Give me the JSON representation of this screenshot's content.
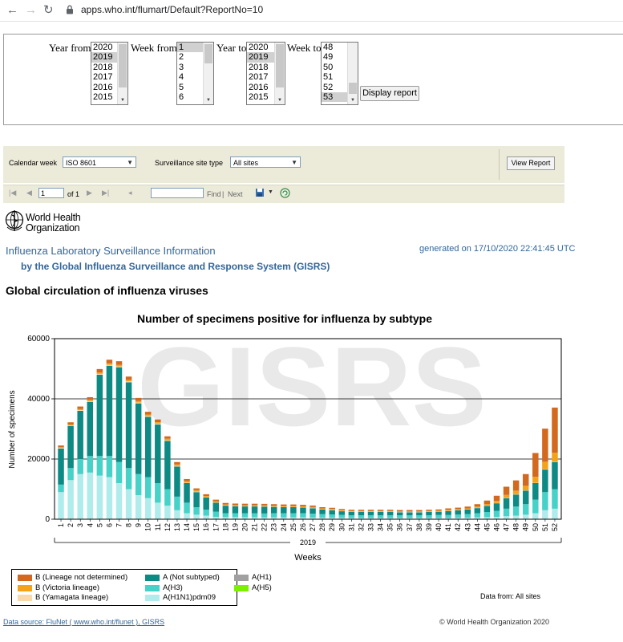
{
  "browser": {
    "url": "apps.who.int/flumart/Default?ReportNo=10"
  },
  "form": {
    "year_from_label": "Year from",
    "week_from_label": "Week from",
    "year_to_label": "Year to",
    "week_to_label": "Week to",
    "year_from_options": [
      "2020",
      "2019",
      "2018",
      "2017",
      "2016",
      "2015"
    ],
    "week_from_options": [
      "1",
      "2",
      "3",
      "4",
      "5",
      "6"
    ],
    "year_to_options": [
      "2020",
      "2019",
      "2018",
      "2017",
      "2016",
      "2015"
    ],
    "week_to_options": [
      "48",
      "49",
      "50",
      "51",
      "52",
      "53"
    ],
    "display_report_label": "Display report"
  },
  "viewer": {
    "calendar_week_label": "Calendar week",
    "calendar_week_value": "ISO 8601",
    "site_type_label": "Surveillance site type",
    "site_type_value": "All sites",
    "view_report_label": "View Report",
    "page_value": "1",
    "of_pages": "of 1",
    "find_label": "Find",
    "next_label": "Next",
    "separator": "|"
  },
  "report": {
    "org_line1": "World Health",
    "org_line2": "Organization",
    "title": "Influenza Laboratory Surveillance Information",
    "subtitle": "by the Global Influenza Surveillance and Response System (GISRS)",
    "generated": "generated on 17/10/2020 22:41:45 UTC",
    "section_title": "Global circulation of influenza viruses",
    "data_from": "Data from: All sites",
    "data_source": "Data source: FluNet ( www.who.int/flunet ), GISRS",
    "copyright": "© World Health Organization 2020"
  },
  "colors": {
    "b_lineage_nd": "#d2691e",
    "b_victoria": "#f5a21a",
    "b_yamagata": "#fbd9a8",
    "a_not_subtyped": "#0e8a84",
    "a_h3": "#46d2c8",
    "a_h1n1pdm09": "#b0ecec",
    "a_h1": "#a0a0a0",
    "a_h5": "#7cf000"
  },
  "chart_data": {
    "type": "bar",
    "stacked": true,
    "title": "Number of specimens positive for influenza by subtype",
    "xlabel": "Weeks",
    "ylabel": "Number of specimens",
    "year_label": "2019",
    "watermark": "GISRS",
    "ylim": [
      0,
      60000
    ],
    "yticks": [
      0,
      20000,
      40000,
      60000
    ],
    "grid": true,
    "legend_position": "bottom-left",
    "categories": [
      "1",
      "2",
      "3",
      "4",
      "5",
      "6",
      "7",
      "8",
      "9",
      "10",
      "11",
      "12",
      "13",
      "14",
      "15",
      "16",
      "17",
      "18",
      "19",
      "20",
      "21",
      "22",
      "23",
      "24",
      "25",
      "26",
      "27",
      "28",
      "29",
      "30",
      "31",
      "32",
      "33",
      "34",
      "35",
      "36",
      "37",
      "38",
      "39",
      "40",
      "41",
      "42",
      "43",
      "44",
      "45",
      "46",
      "47",
      "48",
      "49",
      "50",
      "51",
      "52"
    ],
    "series": [
      {
        "name": "A(H1N1)pdm09",
        "color_key": "a_h1n1pdm09",
        "values": [
          9000,
          13000,
          15000,
          15500,
          14500,
          14000,
          12000,
          10000,
          8000,
          7000,
          5500,
          4500,
          3000,
          2000,
          1500,
          1200,
          800,
          700,
          700,
          650,
          650,
          600,
          600,
          600,
          600,
          600,
          550,
          500,
          500,
          450,
          400,
          400,
          400,
          400,
          400,
          400,
          400,
          400,
          400,
          400,
          400,
          450,
          500,
          600,
          700,
          800,
          1000,
          1200,
          1500,
          2000,
          3000,
          3500
        ]
      },
      {
        "name": "A(H1)",
        "color_key": "a_h1",
        "values": [
          0,
          0,
          0,
          0,
          0,
          0,
          0,
          0,
          0,
          0,
          0,
          0,
          0,
          0,
          0,
          0,
          0,
          0,
          0,
          0,
          0,
          0,
          0,
          0,
          0,
          0,
          0,
          0,
          0,
          0,
          0,
          0,
          0,
          0,
          0,
          0,
          0,
          0,
          0,
          0,
          0,
          0,
          0,
          0,
          0,
          0,
          0,
          0,
          0,
          0,
          0,
          0
        ]
      },
      {
        "name": "A(H3)",
        "color_key": "a_h3",
        "values": [
          2500,
          4000,
          5000,
          5500,
          6500,
          7000,
          7000,
          7000,
          7000,
          7000,
          6500,
          5500,
          4500,
          3500,
          2500,
          2000,
          1700,
          1300,
          1300,
          1300,
          1300,
          1300,
          1400,
          1400,
          1400,
          1400,
          1300,
          1200,
          1100,
          1000,
          900,
          900,
          900,
          900,
          900,
          900,
          900,
          900,
          900,
          1000,
          1000,
          1100,
          1200,
          1400,
          1700,
          2000,
          2500,
          3000,
          3500,
          4500,
          6000,
          6500
        ]
      },
      {
        "name": "A(H5)",
        "color_key": "a_h5",
        "values": [
          0,
          0,
          0,
          0,
          0,
          0,
          0,
          0,
          0,
          0,
          0,
          0,
          0,
          0,
          0,
          0,
          0,
          0,
          0,
          0,
          0,
          0,
          0,
          0,
          0,
          0,
          0,
          0,
          0,
          0,
          0,
          0,
          0,
          0,
          0,
          0,
          0,
          0,
          0,
          0,
          0,
          0,
          0,
          0,
          0,
          0,
          0,
          0,
          0,
          0,
          0,
          0
        ]
      },
      {
        "name": "A (Not subtyped)",
        "color_key": "a_not_subtyped",
        "values": [
          12000,
          14000,
          16000,
          18000,
          27000,
          30000,
          31500,
          28500,
          23500,
          20000,
          19500,
          16000,
          10000,
          6500,
          5000,
          4000,
          3000,
          2500,
          2300,
          2300,
          2300,
          2300,
          2100,
          2000,
          2000,
          1900,
          1800,
          1500,
          1400,
          1200,
          1100,
          1100,
          1100,
          1100,
          1100,
          1000,
          1000,
          1000,
          1100,
          1100,
          1300,
          1400,
          1500,
          1700,
          2000,
          2500,
          3500,
          4000,
          4500,
          5500,
          7500,
          9000
        ]
      },
      {
        "name": "B (Yamagata lineage)",
        "color_key": "b_yamagata",
        "values": [
          200,
          200,
          250,
          250,
          300,
          300,
          300,
          300,
          300,
          300,
          250,
          250,
          200,
          150,
          150,
          100,
          100,
          100,
          100,
          100,
          100,
          100,
          100,
          100,
          100,
          100,
          100,
          100,
          100,
          100,
          100,
          100,
          100,
          100,
          100,
          100,
          100,
          100,
          100,
          100,
          100,
          100,
          100,
          100,
          100,
          100,
          100,
          100,
          100,
          100,
          100,
          100
        ]
      },
      {
        "name": "B (Victoria lineage)",
        "color_key": "b_victoria",
        "values": [
          300,
          300,
          400,
          400,
          500,
          500,
          500,
          500,
          500,
          500,
          500,
          500,
          500,
          500,
          500,
          400,
          400,
          300,
          300,
          300,
          300,
          300,
          300,
          300,
          300,
          300,
          300,
          300,
          300,
          250,
          250,
          250,
          250,
          250,
          250,
          250,
          250,
          250,
          250,
          250,
          300,
          300,
          300,
          400,
          500,
          700,
          1000,
          1200,
          1500,
          2000,
          2500,
          3000
        ]
      },
      {
        "name": "B (Lineage not determined)",
        "color_key": "b_lineage_nd",
        "values": [
          500,
          700,
          800,
          900,
          1100,
          1200,
          1200,
          1100,
          1000,
          900,
          900,
          800,
          800,
          700,
          600,
          600,
          500,
          500,
          500,
          500,
          500,
          500,
          500,
          500,
          500,
          500,
          500,
          400,
          400,
          400,
          400,
          400,
          400,
          400,
          400,
          400,
          400,
          400,
          400,
          400,
          500,
          500,
          600,
          800,
          1200,
          1700,
          2700,
          3400,
          3900,
          7900,
          11000,
          15000
        ]
      }
    ]
  },
  "legend": {
    "col1": [
      {
        "label": "B (Lineage not determined)",
        "color_key": "b_lineage_nd"
      },
      {
        "label": "B (Victoria lineage)",
        "color_key": "b_victoria"
      },
      {
        "label": "B (Yamagata lineage)",
        "color_key": "b_yamagata"
      }
    ],
    "col2": [
      {
        "label": "A (Not subtyped)",
        "color_key": "a_not_subtyped"
      },
      {
        "label": "A(H3)",
        "color_key": "a_h3"
      },
      {
        "label": "A(H1N1)pdm09",
        "color_key": "a_h1n1pdm09"
      }
    ],
    "col3": [
      {
        "label": "A(H1)",
        "color_key": "a_h1"
      },
      {
        "label": "A(H5)",
        "color_key": "a_h5"
      }
    ]
  }
}
